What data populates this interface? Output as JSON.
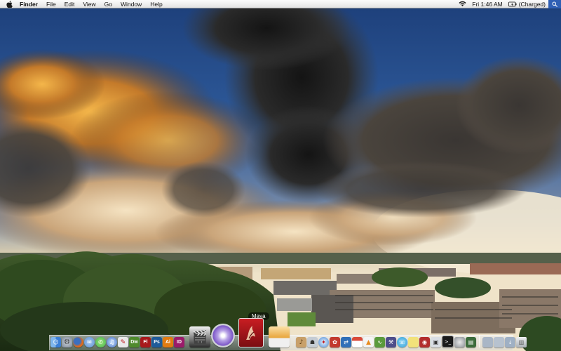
{
  "menubar": {
    "apple_icon": "apple-logo-icon",
    "app_name": "Finder",
    "menus": [
      "File",
      "Edit",
      "View",
      "Go",
      "Window",
      "Help"
    ],
    "clock": "Fri 1:46 AM",
    "battery_status": "(Charged)",
    "wifi_icon": "wifi-icon",
    "battery_icon": "battery-icon",
    "spotlight_icon": "spotlight-search-icon"
  },
  "dock": {
    "tooltip": "Maya",
    "apps_left": [
      {
        "name": "finder",
        "icon": "finder-icon",
        "label": "",
        "color": "#3b7fd6"
      },
      {
        "name": "system-preferences",
        "icon": "gear-icon",
        "label": "",
        "color": "#7c8796"
      },
      {
        "name": "firefox",
        "icon": "firefox-icon",
        "label": "",
        "color": "#e06a1c"
      },
      {
        "name": "mail",
        "icon": "mail-icon",
        "label": "",
        "color": "#5b8fd1"
      },
      {
        "name": "ichat",
        "icon": "chat-icon",
        "label": "",
        "color": "#44b54a"
      },
      {
        "name": "itunes",
        "icon": "music-icon",
        "label": "",
        "color": "#3f6cc4"
      },
      {
        "name": "acrobat",
        "icon": "pdf-icon",
        "label": "",
        "color": "#c9c9c9"
      },
      {
        "name": "dreamweaver",
        "icon": "dreamweaver-icon",
        "label": "Dw",
        "color": "#4f8a2c"
      },
      {
        "name": "flash",
        "icon": "flash-icon",
        "label": "Fl",
        "color": "#a8191c"
      },
      {
        "name": "photoshop",
        "icon": "photoshop-icon",
        "label": "Ps",
        "color": "#1f5b9a"
      },
      {
        "name": "illustrator",
        "icon": "illustrator-icon",
        "label": "Ai",
        "color": "#e07b12"
      },
      {
        "name": "indesign",
        "icon": "indesign-icon",
        "label": "ID",
        "color": "#9a1b6a"
      }
    ],
    "apps_big": [
      {
        "name": "final-cut",
        "icon": "clapperboard-icon",
        "color": "#2b2b2b"
      },
      {
        "name": "dvd-player",
        "icon": "dvd-icon",
        "color": "#7b55c6"
      },
      {
        "name": "maya",
        "icon": "maya-icon",
        "color": "#a3161a"
      },
      {
        "name": "toast",
        "icon": "toast-icon",
        "color": "#e8a43a"
      }
    ],
    "apps_right": [
      {
        "name": "garageband",
        "icon": "guitar-icon",
        "color": "#8a5a2c"
      },
      {
        "name": "automator",
        "icon": "robot-icon",
        "color": "#8d9aa8"
      },
      {
        "name": "safari",
        "icon": "compass-icon",
        "color": "#4b8bd8"
      },
      {
        "name": "cs",
        "icon": "cs-icon",
        "color": "#c23a2e"
      },
      {
        "name": "network-utility",
        "icon": "network-icon",
        "color": "#2f6fb8"
      },
      {
        "name": "ical",
        "icon": "calendar-icon",
        "color": "#d84a3a"
      },
      {
        "name": "vlc",
        "icon": "cone-icon",
        "color": "#e78a1e"
      },
      {
        "name": "audio-tool",
        "icon": "waveform-icon",
        "color": "#5a9a3c"
      },
      {
        "name": "utility",
        "icon": "tool-icon",
        "color": "#4d4d8a"
      },
      {
        "name": "skype",
        "icon": "phone-icon",
        "color": "#2d9fd6"
      },
      {
        "name": "stickies",
        "icon": "note-icon",
        "color": "#d6c23a"
      },
      {
        "name": "photo-booth",
        "icon": "camera-icon",
        "color": "#b22d2d"
      },
      {
        "name": "preview",
        "icon": "preview-icon",
        "color": "#5e7a98"
      },
      {
        "name": "terminal",
        "icon": "terminal-icon",
        "color": "#1a1a1a"
      },
      {
        "name": "disk-utility",
        "icon": "disk-icon",
        "color": "#8a8f95"
      },
      {
        "name": "activity-monitor",
        "icon": "monitor-icon",
        "color": "#3c6c3c"
      }
    ],
    "apps_tray": [
      {
        "name": "applications-stack",
        "icon": "folder-icon",
        "color": "#a9b6c6"
      },
      {
        "name": "documents-stack",
        "icon": "folder-icon",
        "color": "#b7c2cf"
      },
      {
        "name": "downloads-stack",
        "icon": "download-icon",
        "color": "#9fb0c4"
      },
      {
        "name": "trash",
        "icon": "trash-icon",
        "color": "#c7ccd2"
      }
    ]
  }
}
